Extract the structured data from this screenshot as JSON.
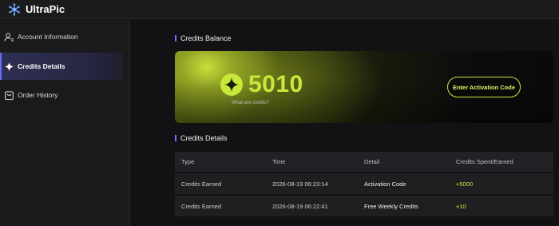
{
  "app": {
    "name": "UltraPic"
  },
  "sidebar": {
    "items": [
      {
        "label": "Account Information",
        "icon": "user-settings-icon",
        "active": false
      },
      {
        "label": "Credits Details",
        "icon": "sparkle-icon",
        "active": true
      },
      {
        "label": "Order History",
        "icon": "shopping-bag-icon",
        "active": false
      }
    ]
  },
  "balance": {
    "title": "Credits Balance",
    "value": "5010",
    "link": "What are credits?",
    "button": "Enter Activation Code",
    "accent": "#c8e83a"
  },
  "details": {
    "title": "Credits Details",
    "columns": [
      "Type",
      "Time",
      "Detail",
      "Credits Spent/Earned"
    ],
    "rows": [
      {
        "type": "Credits Earned",
        "time": "2026-08-19 06:23:14",
        "detail": "Activation Code",
        "amount": "+5000"
      },
      {
        "type": "Credits Earned",
        "time": "2026-08-19 06:22:41",
        "detail": "Free Weekly Credits",
        "amount": "+10"
      }
    ]
  }
}
